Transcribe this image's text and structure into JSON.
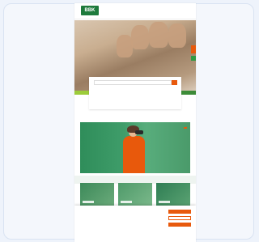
{
  "brand": {
    "logo_text": "BBK",
    "accent_orange": "#e8590c",
    "brand_green": "#1e7a3c"
  },
  "header": {
    "nav": [
      "",
      ""
    ],
    "utility": [
      "",
      ""
    ]
  },
  "hero": {
    "title": "",
    "subtitle": ""
  },
  "service_box": {
    "search_placeholder": "",
    "col1_title": "",
    "col1_lines": [
      "",
      ""
    ],
    "col2_title": "",
    "col2_lines": [
      "",
      ""
    ],
    "link": ""
  },
  "promo": {
    "title": "",
    "badge": ""
  },
  "cards": [
    {
      "label": ""
    },
    {
      "label": ""
    },
    {
      "label": ""
    }
  ],
  "cookie_banner": {
    "text": "",
    "buttons": [
      "",
      "",
      ""
    ],
    "links": [
      "",
      "",
      ""
    ]
  }
}
